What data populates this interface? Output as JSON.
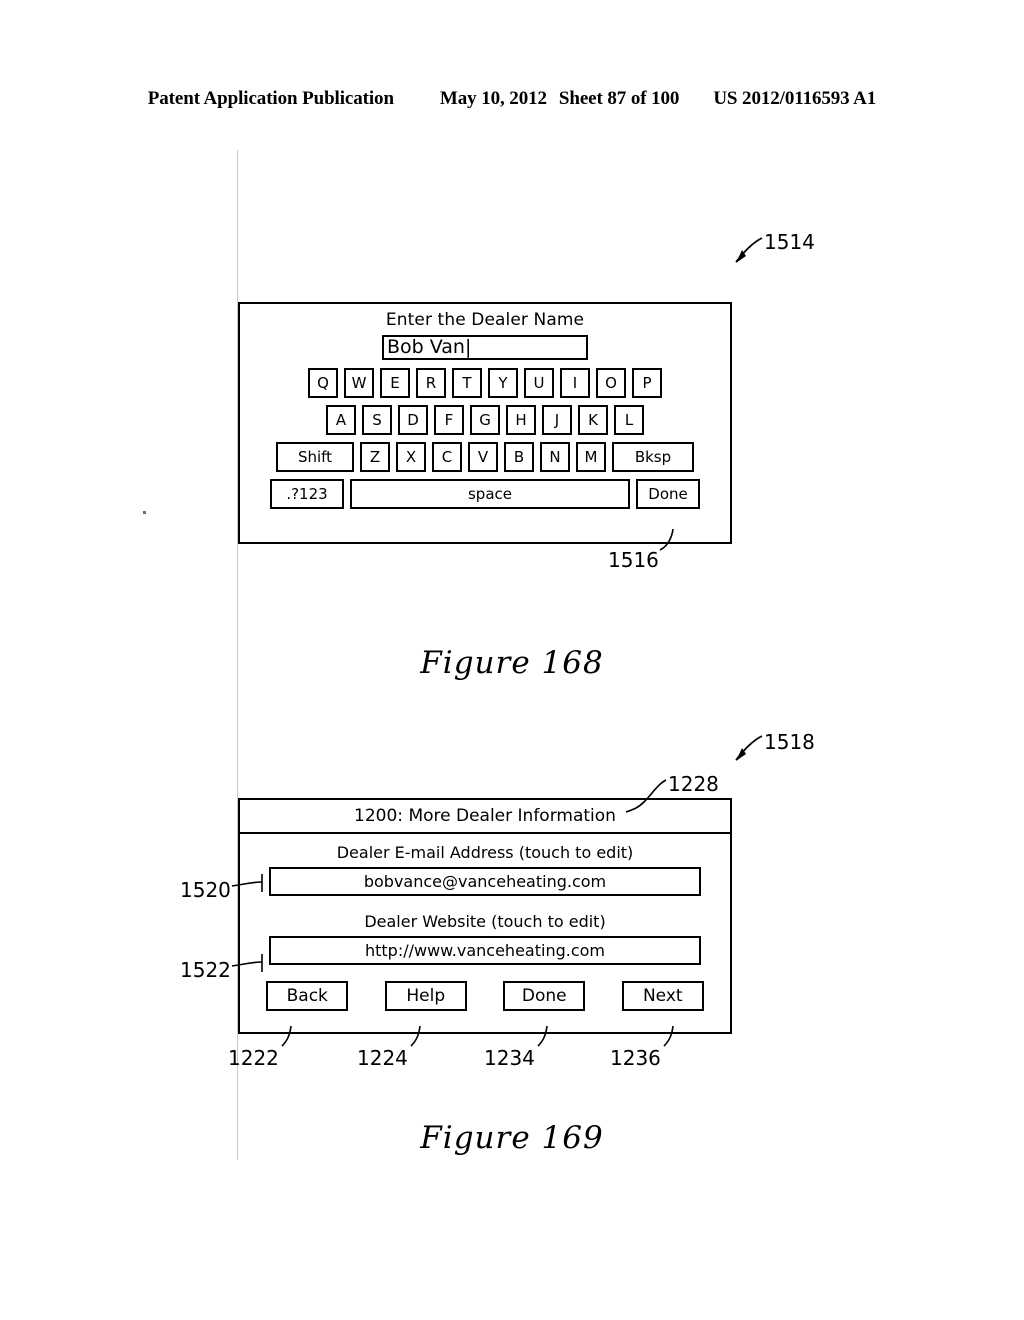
{
  "header": {
    "publication": "Patent Application Publication",
    "date": "May 10, 2012",
    "sheet": "Sheet 87 of 100",
    "patent_number": "US 2012/0116593 A1"
  },
  "figure168": {
    "caption": "Figure 168",
    "ref_device": "1514",
    "ref_done": "1516",
    "title": "Enter the Dealer Name",
    "input_value": "Bob Van|",
    "keyboard": {
      "row1": [
        "Q",
        "W",
        "E",
        "R",
        "T",
        "Y",
        "U",
        "I",
        "O",
        "P"
      ],
      "row2": [
        "A",
        "S",
        "D",
        "F",
        "G",
        "H",
        "J",
        "K",
        "L"
      ],
      "row3_shift": "Shift",
      "row3": [
        "Z",
        "X",
        "C",
        "V",
        "B",
        "N",
        "M"
      ],
      "row3_bksp": "Bksp",
      "row4_numeric": ".?123",
      "row4_space": "space",
      "row4_done": "Done"
    }
  },
  "figure169": {
    "caption": "Figure 169",
    "ref_device": "1518",
    "ref_titlebar": "1228",
    "title": "1200: More Dealer Information",
    "fields": [
      {
        "label": "Dealer E-mail Address (touch to edit)",
        "value": "bobvance@vanceheating.com",
        "ref": "1520"
      },
      {
        "label": "Dealer Website (touch to edit)",
        "value": "http://www.vanceheating.com",
        "ref": "1522"
      }
    ],
    "buttons": [
      {
        "label": "Back",
        "ref": "1222"
      },
      {
        "label": "Help",
        "ref": "1224"
      },
      {
        "label": "Done",
        "ref": "1234"
      },
      {
        "label": "Next",
        "ref": "1236"
      }
    ]
  }
}
